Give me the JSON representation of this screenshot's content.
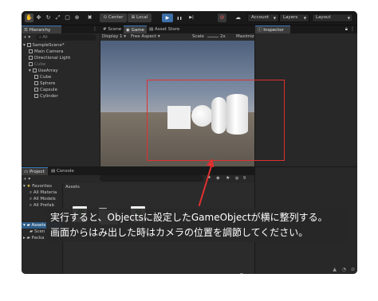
{
  "toolbar": {
    "tool_icons": [
      "hand-icon",
      "move-icon",
      "rotate-icon",
      "scale-icon",
      "rect-icon",
      "transform-icon",
      "custom-tool-icon"
    ],
    "pivot_label": "Center",
    "space_label": "Local",
    "play_icon": "▶",
    "pause_icon": "❚❚",
    "step_icon": "▶|",
    "account_label": "Account",
    "layers_label": "Layers",
    "layout_label": "Layout"
  },
  "hierarchy": {
    "tab_label": "Hierarchy",
    "add_button": "+ ▾",
    "search_filter": "All",
    "items": [
      {
        "label": "SampleScene*",
        "indent": 0,
        "expander": "▾"
      },
      {
        "label": "Main Camera",
        "indent": 1
      },
      {
        "label": "Directional Light",
        "indent": 1
      },
      {
        "label": "Cube",
        "indent": 1,
        "dim": true
      },
      {
        "label": "UseArray",
        "indent": 1,
        "expander": "▾"
      },
      {
        "label": "Cube",
        "indent": 2
      },
      {
        "label": "Sphere",
        "indent": 2
      },
      {
        "label": "Capsule",
        "indent": 2
      },
      {
        "label": "Cylinder",
        "indent": 2
      }
    ]
  },
  "game_view": {
    "tabs": [
      "Scene",
      "Game",
      "Asset Store"
    ],
    "display": "Display 1",
    "aspect": "Free Aspect",
    "scale_label": "Scale",
    "scale_value": "2x",
    "maximize_label": "Maximiz"
  },
  "inspector": {
    "tab_label": "Inspector"
  },
  "project": {
    "tabs": [
      "Project",
      "Console"
    ],
    "add_button": "+ ▾",
    "favorites_label": "Favorites",
    "favorites": [
      "All Materia",
      "All Models",
      "All Prefab"
    ],
    "assets_label": "Assets",
    "assets_children": [
      "Scen"
    ],
    "packages_label": "Packa",
    "breadcrumb": "Assets",
    "badge_count": "9"
  },
  "caption": {
    "line1": "実行すると、Objectsに設定したGameObjectが横に整列する。",
    "line2": "画面からはみ出した時はカメラの位置を調節してください。"
  },
  "colors": {
    "accent": "#3a79bb",
    "play_active": "#3d6fa8",
    "highlight": "#e03030",
    "script_icon": "#1c7a2a"
  }
}
